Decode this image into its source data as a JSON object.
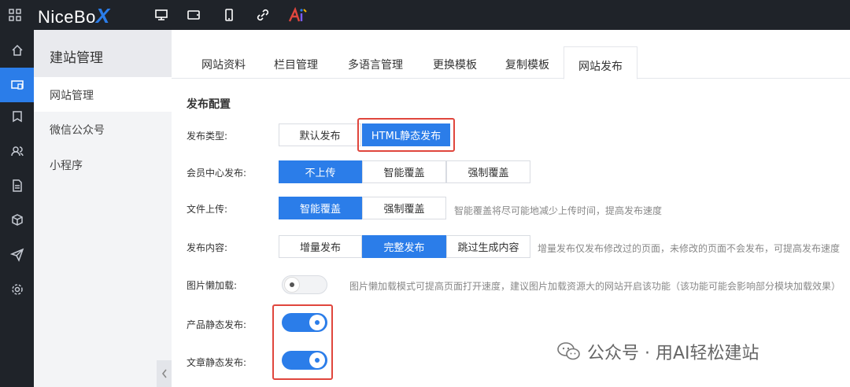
{
  "app": {
    "logo_text": "NiceBo",
    "logo_x": "X"
  },
  "topbar_icons": [
    "grid-icon",
    "desktop-icon",
    "tablet-icon",
    "mobile-icon",
    "link-icon",
    "ai-logo-icon"
  ],
  "dark_sidebar": [
    "home-icon",
    "website-icon",
    "tag-icon",
    "users-icon",
    "document-icon",
    "cube-icon",
    "send-icon",
    "settings-icon"
  ],
  "sidebar": {
    "title": "建站管理",
    "items": [
      {
        "label": "网站管理"
      },
      {
        "label": "微信公众号"
      },
      {
        "label": "小程序"
      }
    ]
  },
  "tabs": [
    {
      "label": "网站资料"
    },
    {
      "label": "栏目管理"
    },
    {
      "label": "多语言管理"
    },
    {
      "label": "更换模板"
    },
    {
      "label": "复制模板"
    },
    {
      "label": "网站发布"
    }
  ],
  "active_tab": "网站发布",
  "section_title": "发布配置",
  "rows": {
    "publish_type": {
      "label": "发布类型:",
      "options": [
        "默认发布",
        "HTML静态发布"
      ],
      "selected": "HTML静态发布"
    },
    "member_center": {
      "label": "会员中心发布:",
      "options": [
        "不上传",
        "智能覆盖",
        "强制覆盖"
      ],
      "selected": "不上传"
    },
    "file_upload": {
      "label": "文件上传:",
      "options": [
        "智能覆盖",
        "强制覆盖"
      ],
      "selected": "智能覆盖",
      "hint": "智能覆盖将尽可能地减少上传时间，提高发布速度"
    },
    "publish_content": {
      "label": "发布内容:",
      "options": [
        "增量发布",
        "完整发布",
        "跳过生成内容"
      ],
      "selected": "完整发布",
      "hint": "增量发布仅发布修改过的页面，未修改的页面不会发布，可提高发布速度"
    },
    "lazy_load": {
      "label": "图片懒加载:",
      "enabled": false,
      "hint": "图片懒加载模式可提高页面打开速度，建议图片加载资源大的网站开启该功能（该功能可能会影响部分模块加载效果）"
    },
    "product_static": {
      "label": "产品静态发布:",
      "enabled": true
    },
    "article_static": {
      "label": "文章静态发布:",
      "enabled": true
    }
  },
  "watermark": {
    "text": "公众号 · 用AI轻松建站"
  },
  "colors": {
    "accent": "#2b7de9",
    "highlight": "#e0463d",
    "topbar": "#1f2329"
  }
}
